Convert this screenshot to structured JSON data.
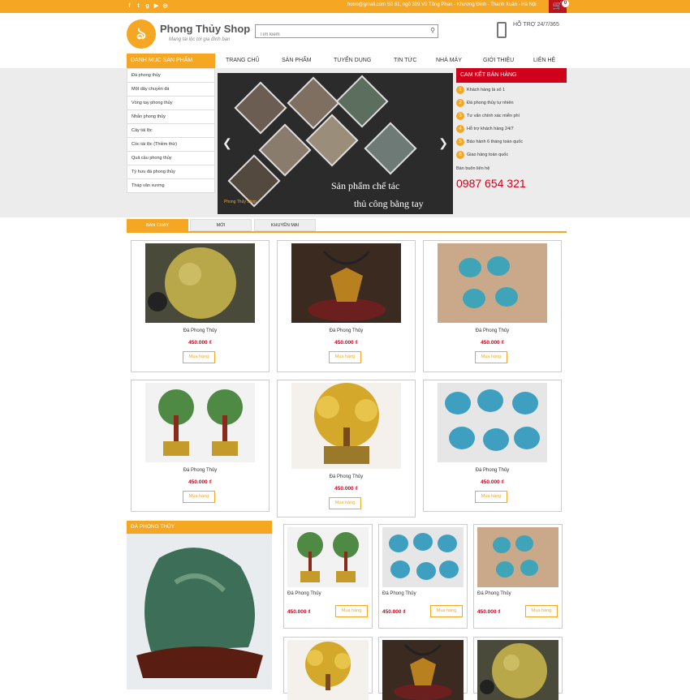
{
  "topbar": {
    "social_icons": [
      "facebook-icon",
      "twitter-icon",
      "google-plus-icon",
      "youtube-icon",
      "instagram-icon"
    ],
    "contact_text": "hotro@gmail.com  Số 81, ngõ 309 Vũ Tông Phan - Khương Đình - Thanh Xuân - Hà Nội",
    "cart_count": "0"
  },
  "header": {
    "logo_name": "Phong Thủy Shop",
    "logo_tagline": "Mang tài lộc tới gia đình bạn",
    "search_placeholder": "Tìm kiếm",
    "support_text": "HỖ TRỢ 24/7/365"
  },
  "nav": {
    "category_header": "DANH MỤC SẢN PHẨM",
    "items": [
      "TRANG CHỦ",
      "SẢN PHẨM",
      "TUYỂN DỤNG",
      "TIN TỨC",
      "NHÀ MÁY",
      "GIỚI THIỆU",
      "LIÊN HỆ"
    ]
  },
  "categories": [
    "Đá phong thủy",
    "Một dây chuyền đá",
    "Vòng tay phong thủy",
    "Nhẫn phong thủy",
    "Cây tài lộc",
    "Cóc tài lộc (Thiềm thừ)",
    "Quả cầu phong thủy",
    "Tỳ hưu đá phong thủy",
    "Tháp văn xương"
  ],
  "slider": {
    "caption_line1": "Sản phẩm chế tác",
    "caption_line2": "thủ công bằng tay",
    "small_logo": "Phong Thủy Shop"
  },
  "commitment": {
    "title": "CAM KẾT BÁN HÀNG",
    "items": [
      "Khách hàng là số 1",
      "Đá phong thủy tự nhiên",
      "Tư vấn chính xác miễn phí",
      "Hỗ trợ khách hàng 24/7",
      "Bảo hành 6 tháng toàn quốc",
      "Giao hàng toàn quốc"
    ],
    "hotline_label": "Bán buôn liên hệ",
    "hotline": "0987 654 321"
  },
  "tabs": [
    "BÁN CHẠY",
    "MỚI",
    "KHUYẾN MẠI"
  ],
  "products": [
    {
      "name": "Đá Phong Thủy",
      "price": "450.000 ₫",
      "buy": "Mua hàng",
      "image": "yellow-sphere"
    },
    {
      "name": "Đá Phong Thủy",
      "price": "450.000 ₫",
      "buy": "Mua hàng",
      "image": "fox-pendant"
    },
    {
      "name": "Đá Phong Thủy",
      "price": "450.000 ₫",
      "buy": "Mua hàng",
      "image": "blue-toads-hand"
    },
    {
      "name": "Đá Phong Thủy",
      "price": "450.000 ₫",
      "buy": "Mua hàng",
      "image": "twin-trees"
    },
    {
      "name": "Đá Phong Thủy",
      "price": "450.000 ₫",
      "buy": "Mua hàng",
      "image": "gold-tree"
    },
    {
      "name": "Đá Phong Thủy",
      "price": "450.000 ₫",
      "buy": "Mua hàng",
      "image": "blue-toads"
    }
  ],
  "sidebox": {
    "title": "ĐÁ PHONG THỦY"
  },
  "small_products": [
    {
      "name": "Đá Phong Thủy",
      "price": "450.000 ₫",
      "buy": "Mua hàng",
      "image": "twin-trees"
    },
    {
      "name": "Đá Phong Thủy",
      "price": "450.000 ₫",
      "buy": "Mua hàng",
      "image": "blue-toads"
    },
    {
      "name": "Đá Phong Thủy",
      "price": "450.000 ₫",
      "buy": "Mua hàng",
      "image": "blue-toads-hand"
    },
    {
      "name": "",
      "price": "",
      "buy": "",
      "image": "gold-tree"
    },
    {
      "name": "",
      "price": "",
      "buy": "",
      "image": "fox-pendant"
    },
    {
      "name": "",
      "price": "",
      "buy": "",
      "image": "yellow-sphere"
    }
  ],
  "watermark": "PHONGTHUYSHOP.COM.VN",
  "colors": {
    "accent": "#f5a623",
    "red": "#d0021b",
    "cart": "#c0121a"
  }
}
